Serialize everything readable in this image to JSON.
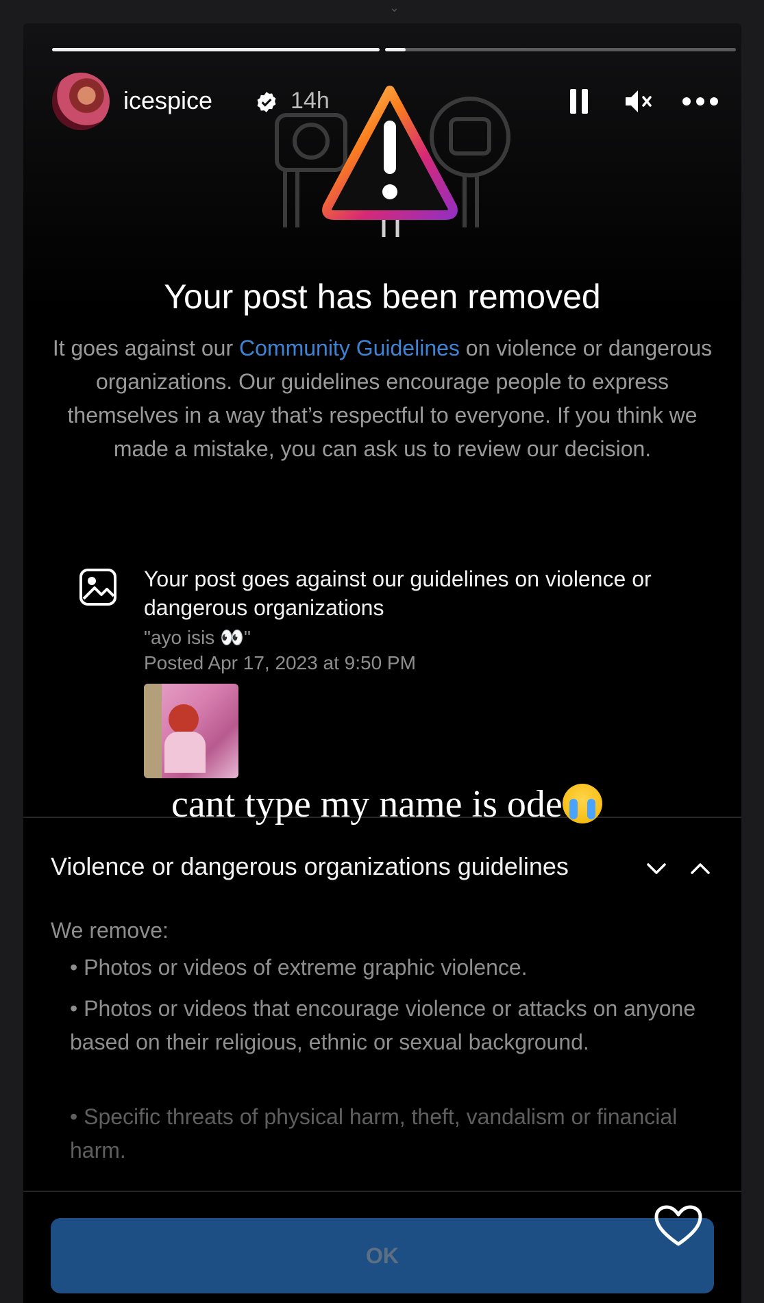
{
  "story": {
    "username": "icespice",
    "time_ago": "14h"
  },
  "notice": {
    "title": "Your post has been removed",
    "desc_prefix": "It goes against our ",
    "desc_link": "Community Guidelines",
    "desc_suffix": " on violence or dangerous organizations. Our guidelines encourage people to express themselves in a way that’s respectful to everyone. If you think we made a mistake, you can ask us to review our decision."
  },
  "post": {
    "headline": "Your post goes against our guidelines on violence or dangerous organizations",
    "caption": "\"ayo isis 👀\"",
    "posted": "Posted Apr 17, 2023 at 9:50 PM"
  },
  "overlay": {
    "text": "cant type my name is ode"
  },
  "guidelines": {
    "section_title": "Violence or dangerous organizations guidelines",
    "intro": "We remove:",
    "rules": [
      "• Photos or videos of extreme graphic violence.",
      "• Photos or videos that encourage violence or attacks on anyone based on their religious, ethnic or sexual background.",
      "• Specific threats of physical harm, theft, vandalism or financial harm."
    ]
  },
  "actions": {
    "ok_label": "OK"
  },
  "colors": {
    "link": "#3d84d6",
    "ok_button": "#1d4f85",
    "background": "#000000"
  },
  "icons": [
    "chevron-down-icon",
    "verified-icon",
    "pause-icon",
    "mute-icon",
    "more-icon",
    "warning-icon",
    "image-icon",
    "chevron-up-icon",
    "heart-icon"
  ]
}
